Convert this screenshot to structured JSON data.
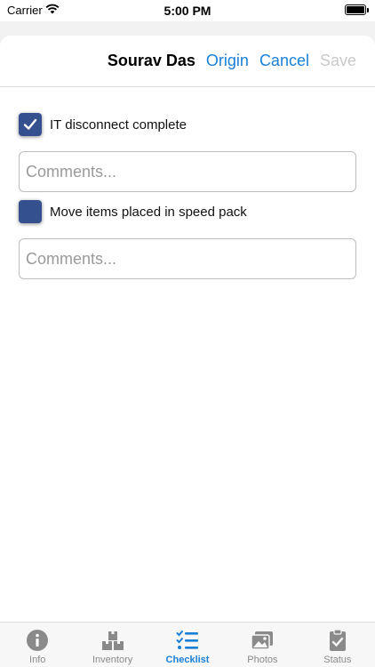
{
  "status_bar": {
    "carrier": "Carrier",
    "time": "5:00 PM"
  },
  "nav": {
    "title": "Sourav Das",
    "origin": "Origin",
    "cancel": "Cancel",
    "save": "Save"
  },
  "checklist": [
    {
      "label": "IT disconnect complete",
      "checked": true,
      "comment_placeholder": "Comments...",
      "comment_value": ""
    },
    {
      "label": "Move items placed in speed pack",
      "checked": false,
      "comment_placeholder": "Comments...",
      "comment_value": ""
    }
  ],
  "tabs": [
    {
      "label": "Info",
      "icon": "info-icon",
      "active": false
    },
    {
      "label": "Inventory",
      "icon": "boxes-icon",
      "active": false
    },
    {
      "label": "Checklist",
      "icon": "checklist-icon",
      "active": true
    },
    {
      "label": "Photos",
      "icon": "photos-icon",
      "active": false
    },
    {
      "label": "Status",
      "icon": "clipboard-check-icon",
      "active": false
    }
  ],
  "colors": {
    "accent": "#1a7fd6",
    "checkbox": "#34508e",
    "disabled": "#c9c9c9",
    "inactive_tab": "#8a8a8a"
  }
}
